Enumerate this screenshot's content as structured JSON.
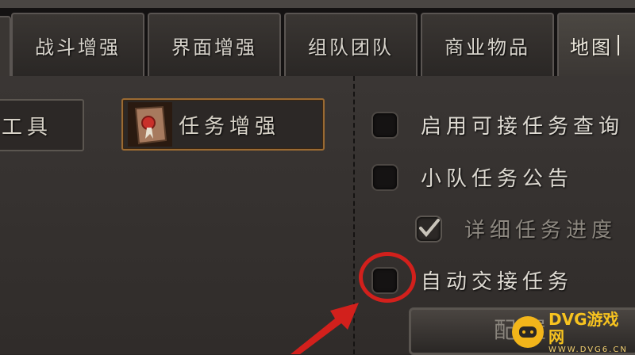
{
  "tabs": [
    {
      "label": "战斗增强"
    },
    {
      "label": "界面增强"
    },
    {
      "label": "组队团队"
    },
    {
      "label": "商业物品"
    },
    {
      "label": "地图"
    }
  ],
  "categories": {
    "tools": "工具",
    "quest": "任务增强"
  },
  "options": [
    {
      "label": "启用可接任务查询",
      "checked": false
    },
    {
      "label": "小队任务公告",
      "checked": false
    },
    {
      "label": "详细任务进度",
      "checked": true,
      "disabled": true
    },
    {
      "label": "自动交接任务",
      "checked": false
    }
  ],
  "config_button": "配置",
  "watermark": {
    "main": "DVG游戏网",
    "sub": "WWW.DVG6.CN"
  },
  "colors": {
    "highlight_ring": "#d2201c",
    "arrow": "#d2201c",
    "active_border": "#9a6a32"
  }
}
